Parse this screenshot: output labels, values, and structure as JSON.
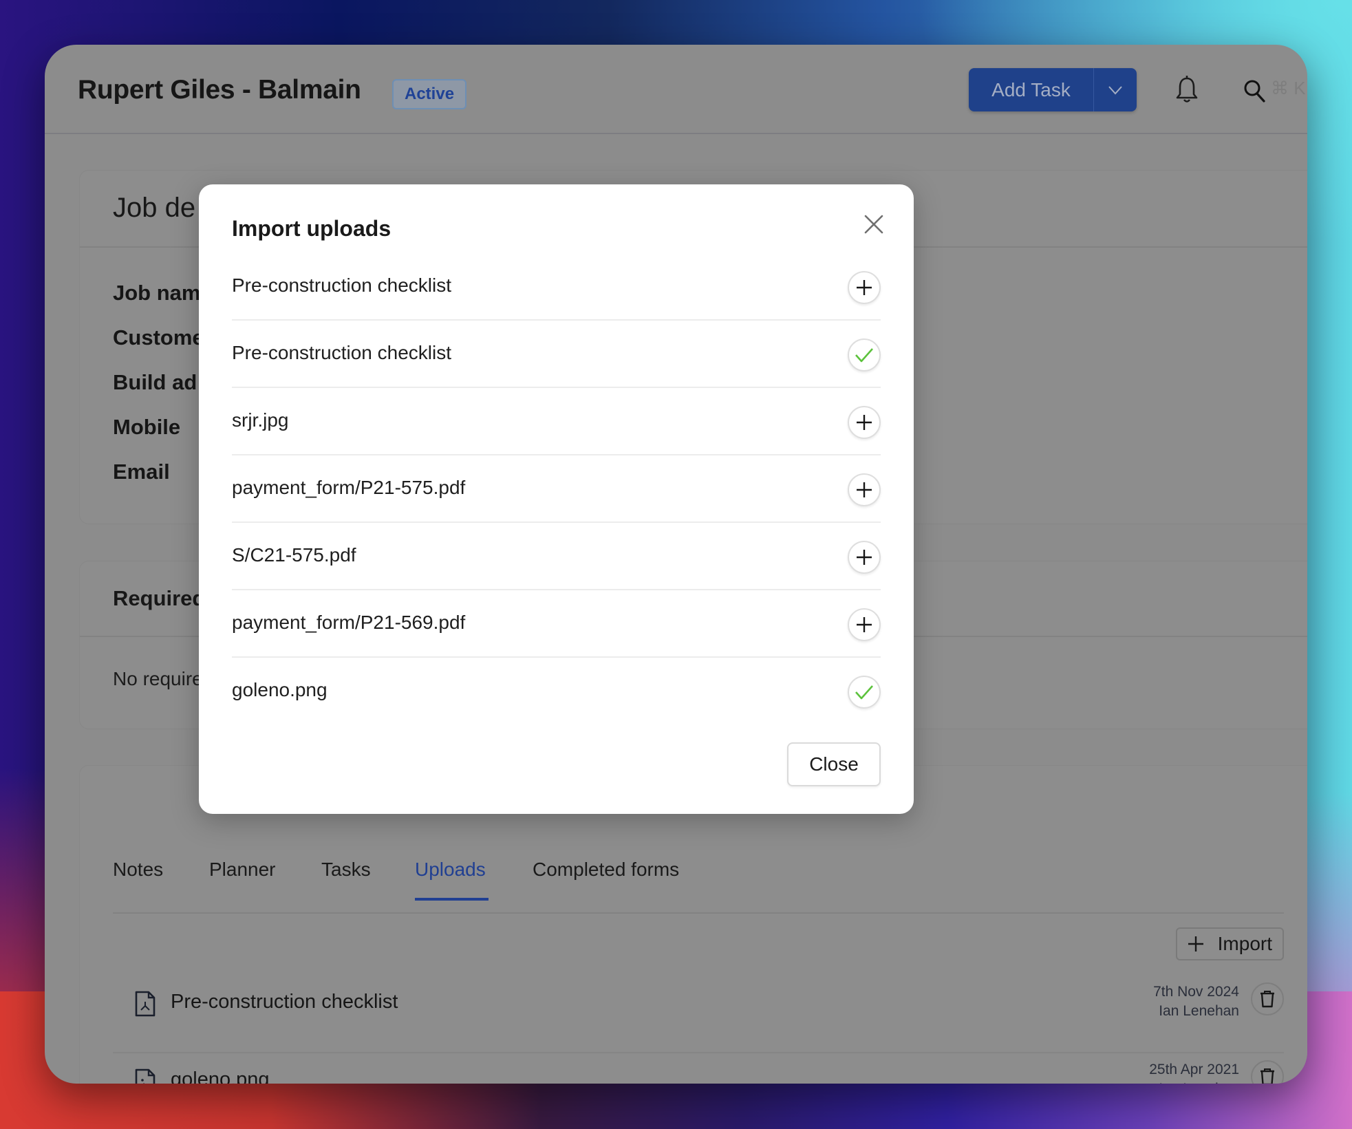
{
  "header": {
    "title": "Rupert Giles - Balmain",
    "status_badge": "Active",
    "add_task_label": "Add Task",
    "search_shortcut": "⌘ K"
  },
  "job_details": {
    "title": "Job de",
    "fields": [
      {
        "label": "Job nam"
      },
      {
        "label": "Custome"
      },
      {
        "label": "Build ad"
      },
      {
        "label": "Mobile"
      },
      {
        "label": "Email"
      }
    ]
  },
  "required": {
    "title": "Required",
    "empty_text": "No require"
  },
  "tabs": [
    {
      "label": "Notes",
      "active": false
    },
    {
      "label": "Planner",
      "active": false
    },
    {
      "label": "Tasks",
      "active": false
    },
    {
      "label": "Uploads",
      "active": true
    },
    {
      "label": "Completed forms",
      "active": false
    }
  ],
  "uploads": {
    "import_label": "Import",
    "items": [
      {
        "name": "Pre-construction checklist",
        "icon": "pdf-file-icon",
        "date": "7th Nov 2024",
        "author": "Ian Lenehan"
      },
      {
        "name": "goleno.png",
        "icon": "image-file-icon",
        "date": "25th Apr 2021",
        "author": "Ian Lenehan"
      }
    ]
  },
  "modal": {
    "title": "Import uploads",
    "close_label": "Close",
    "items": [
      {
        "name": "Pre-construction checklist",
        "state": "add"
      },
      {
        "name": "Pre-construction checklist",
        "state": "imported"
      },
      {
        "name": "srjr.jpg",
        "state": "add"
      },
      {
        "name": "payment_form/P21-575.pdf",
        "state": "add"
      },
      {
        "name": "S/C21-575.pdf",
        "state": "add"
      },
      {
        "name": "payment_form/P21-569.pdf",
        "state": "add"
      },
      {
        "name": "goleno.png",
        "state": "imported"
      }
    ]
  },
  "colors": {
    "accent": "#203f92",
    "check": "#5cc23c"
  }
}
